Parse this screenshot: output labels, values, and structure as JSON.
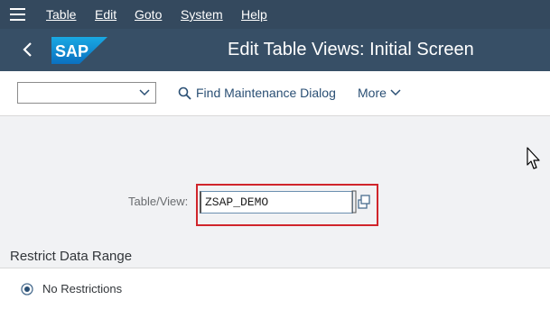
{
  "menubar": {
    "items": [
      {
        "label": "Table"
      },
      {
        "label": "Edit"
      },
      {
        "label": "Goto"
      },
      {
        "label": "System"
      },
      {
        "label": "Help"
      }
    ]
  },
  "header": {
    "logo_text": "SAP",
    "title": "Edit Table Views: Initial Screen"
  },
  "toolbar": {
    "dropdown_value": "",
    "find_label": "Find Maintenance Dialog",
    "more_label": "More"
  },
  "form": {
    "table_view_label": "Table/View:",
    "table_view_value": "ZSAP_DEMO"
  },
  "restrict": {
    "title": "Restrict Data Range",
    "options": [
      {
        "label": "No Restrictions",
        "selected": true
      }
    ]
  },
  "colors": {
    "menubar_bg": "#34495e",
    "titlebar_bg": "#374f66",
    "accent": "#2a4f74",
    "highlight": "#d0252b"
  }
}
